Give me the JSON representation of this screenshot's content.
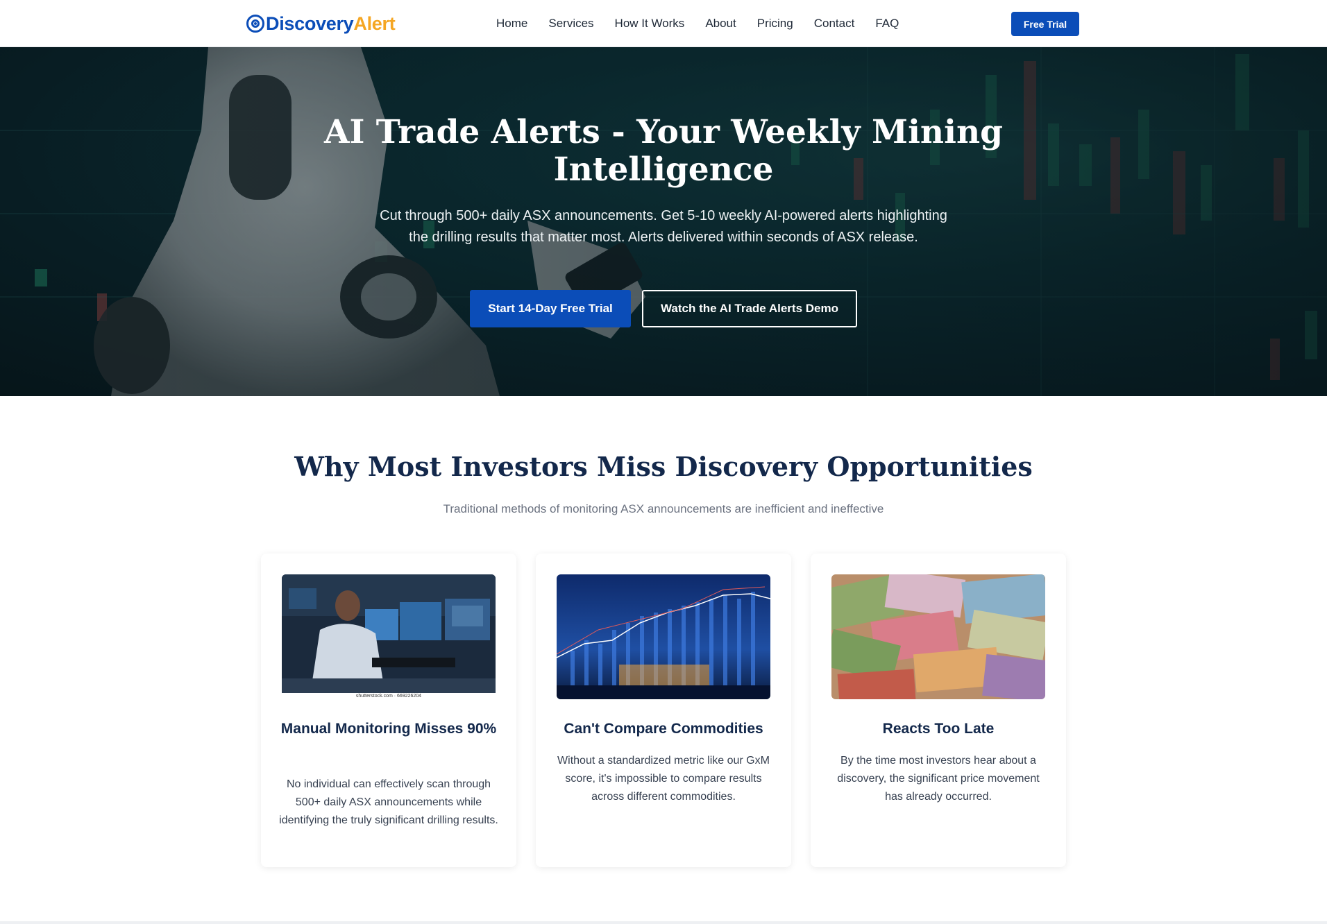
{
  "nav": {
    "logo_part1": "Discovery",
    "logo_part2": "Alert",
    "links": [
      "Home",
      "Services",
      "How It Works",
      "About",
      "Pricing",
      "Contact",
      "FAQ"
    ],
    "cta": "Free Trial"
  },
  "hero": {
    "title": "AI Trade Alerts - Your Weekly Mining Intelligence",
    "subtitle": "Cut through 500+ daily ASX announcements. Get 5-10 weekly AI-powered alerts highlighting the drilling results that matter most. Alerts delivered within seconds of ASX release.",
    "primary_button": "Start 14-Day Free Trial",
    "secondary_button": "Watch the AI Trade Alerts Demo"
  },
  "section": {
    "title": "Why Most Investors Miss Discovery Opportunities",
    "subtitle": "Traditional methods of monitoring ASX announcements are inefficient and ineffective"
  },
  "cards": [
    {
      "title": "Manual Monitoring Misses 90%",
      "text": "No individual can effectively scan through 500+ daily ASX announcements while identifying the truly significant drilling results.",
      "image_credit": "shutterstock.com · 669226204"
    },
    {
      "title": "Can't Compare Commodities",
      "text": "Without a standardized metric like our GxM score, it's impossible to compare results across different commodities."
    },
    {
      "title": "Reacts Too Late",
      "text": "By the time most investors hear about a discovery, the significant price movement has already occurred."
    }
  ],
  "colors": {
    "brand_blue": "#0b4db8",
    "brand_orange": "#f5a623",
    "heading_navy": "#13284b"
  }
}
